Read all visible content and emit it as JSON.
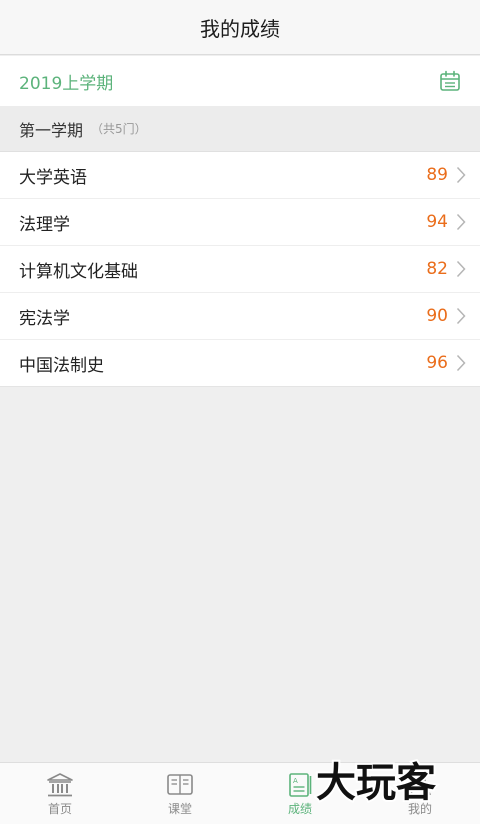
{
  "header": {
    "title": "我的成绩"
  },
  "term": {
    "label": "2019上学期",
    "icon": "calendar-icon"
  },
  "section": {
    "title": "第一学期",
    "count": "（共5门）"
  },
  "courses": [
    {
      "name": "大学英语",
      "score": "89"
    },
    {
      "name": "法理学",
      "score": "94"
    },
    {
      "name": "计算机文化基础",
      "score": "82"
    },
    {
      "name": "宪法学",
      "score": "90"
    },
    {
      "name": "中国法制史",
      "score": "96"
    }
  ],
  "tabs": [
    {
      "label": "首页",
      "icon": "home-icon",
      "active": false
    },
    {
      "label": "课堂",
      "icon": "book-icon",
      "active": false
    },
    {
      "label": "成绩",
      "icon": "grades-icon",
      "active": true
    },
    {
      "label": "我的",
      "icon": "profile-icon",
      "active": false
    }
  ],
  "watermark": {
    "text": "大玩客"
  },
  "colors": {
    "accent_green": "#5cb37b",
    "score_orange": "#ea6d1b",
    "background": "#efefef"
  }
}
